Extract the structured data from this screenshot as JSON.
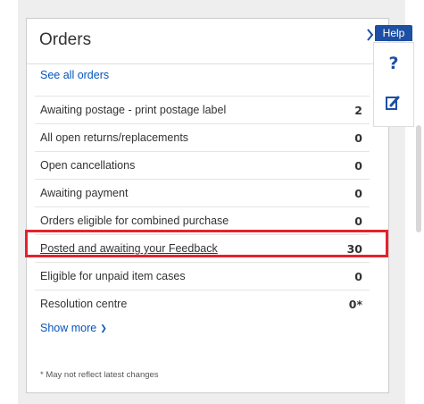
{
  "orders": {
    "title": "Orders",
    "see_all_label": "See all orders",
    "rows": [
      {
        "label": "Awaiting postage - print postage label",
        "count": "2"
      },
      {
        "label": "All open returns/replacements",
        "count": "0"
      },
      {
        "label": "Open cancellations",
        "count": "0"
      },
      {
        "label": "Awaiting payment",
        "count": "0"
      },
      {
        "label": "Orders eligible for combined purchase",
        "count": "0"
      },
      {
        "label": "Posted and awaiting your Feedback",
        "count": "30"
      },
      {
        "label": "Eligible for unpaid item cases",
        "count": "0"
      },
      {
        "label": "Resolution centre",
        "count": "0*"
      }
    ],
    "show_more_label": "Show more",
    "footnote": "* May not reflect latest changes"
  },
  "help": {
    "tab_label": "Help",
    "question_glyph": "?"
  },
  "icons": {
    "help_question": "question-mark-icon",
    "feedback_edit": "edit-feedback-icon",
    "show_more": "chevron-down-icon"
  },
  "colors": {
    "link": "#0654ba",
    "highlight": "#e3232c",
    "help_blue": "#1d4fa3"
  }
}
